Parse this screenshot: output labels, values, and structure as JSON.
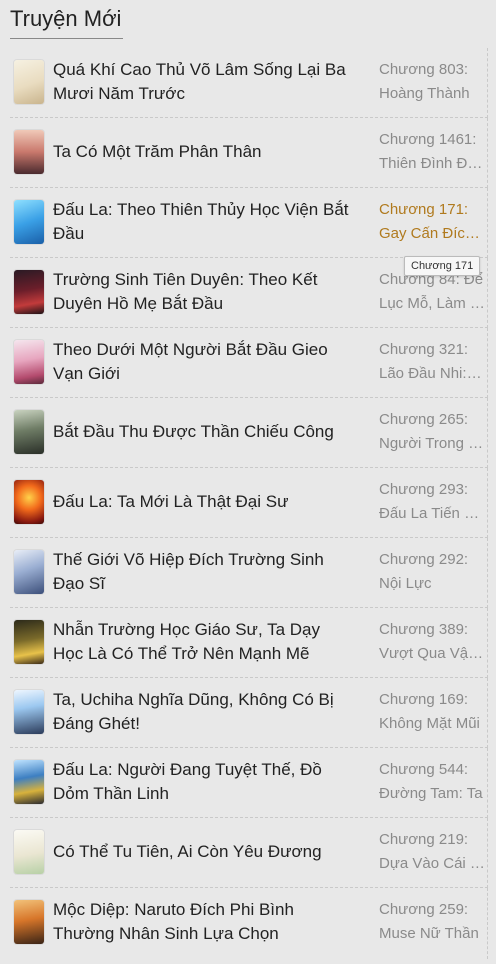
{
  "header": {
    "title": "Truyện Mới"
  },
  "tooltip": "Chương 171",
  "stories": [
    {
      "title": "Quá Khí Cao Thủ Võ Lâm Sống Lại Ba Mươi Năm Trước",
      "chapter_num": "Chương 803:",
      "chapter_name": "Hoàng Thành"
    },
    {
      "title": "Ta Có Một Trăm Phân Thân",
      "chapter_num": "Chương 1461:",
      "chapter_name": "Thiên Đình Đại Chiến"
    },
    {
      "title": "Đấu La: Theo Thiên Thủy Học Viện Bắt Đầu",
      "chapter_num": "Chương 171:",
      "chapter_name": "Gay Cấn Đích Chiến Đấu"
    },
    {
      "title": "Trường Sinh Tiên Duyên: Theo Kết Duyên Hồ Mẹ Bắt Đầu",
      "chapter_num": "Chương 84: Để",
      "chapter_name": "Lục Mỗ, Làm Gì"
    },
    {
      "title": "Theo Dưới Một Người Bắt Đầu Gieo Vạn Giới",
      "chapter_num": "Chương 321:",
      "chapter_name": "Lão Đầu Nhi: Ta"
    },
    {
      "title": "Bắt Đầu Thu Được Thần Chiếu Công",
      "chapter_num": "Chương 265:",
      "chapter_name": "Người Trong Giang Hồ"
    },
    {
      "title": "Đấu La: Ta Mới Là Thật Đại Sư",
      "chapter_num": "Chương 293:",
      "chapter_name": "Đấu La Tiến Hóa"
    },
    {
      "title": "Thế Giới Võ Hiệp Đích Trường Sinh Đạo Sĩ",
      "chapter_num": "Chương 292:",
      "chapter_name": "Nội Lực"
    },
    {
      "title": "Nhẫn Trường Học Giáo Sư, Ta Dạy Học Là Có Thể Trở Nên Mạnh Mẽ",
      "chapter_num": "Chương 389:",
      "chapter_name": "Vượt Qua Vận Mệnh"
    },
    {
      "title": "Ta, Uchiha Nghĩa Dũng, Không Có Bị Đáng Ghét!",
      "chapter_num": "Chương 169:",
      "chapter_name": "Không Mặt Mũi"
    },
    {
      "title": "Đấu La: Người Đang Tuyệt Thế, Đồ Dỏm Thần Linh",
      "chapter_num": "Chương 544:",
      "chapter_name": "Đường Tam: Ta"
    },
    {
      "title": "Có Thể Tu Tiên, Ai Còn Yêu Đương",
      "chapter_num": "Chương 219:",
      "chapter_name": "Dựa Vào Cái Gì"
    },
    {
      "title": "Mộc Diệp: Naruto Đích Phi Bình Thường Nhân Sinh Lựa Chọn",
      "chapter_num": "Chương 259:",
      "chapter_name": "Muse Nữ Thần"
    }
  ],
  "colors": {
    "background": "#e8e8e8",
    "title_text": "#222222",
    "chapter_text": "#8a8a8a",
    "chapter_highlight": "#b07a1e"
  }
}
